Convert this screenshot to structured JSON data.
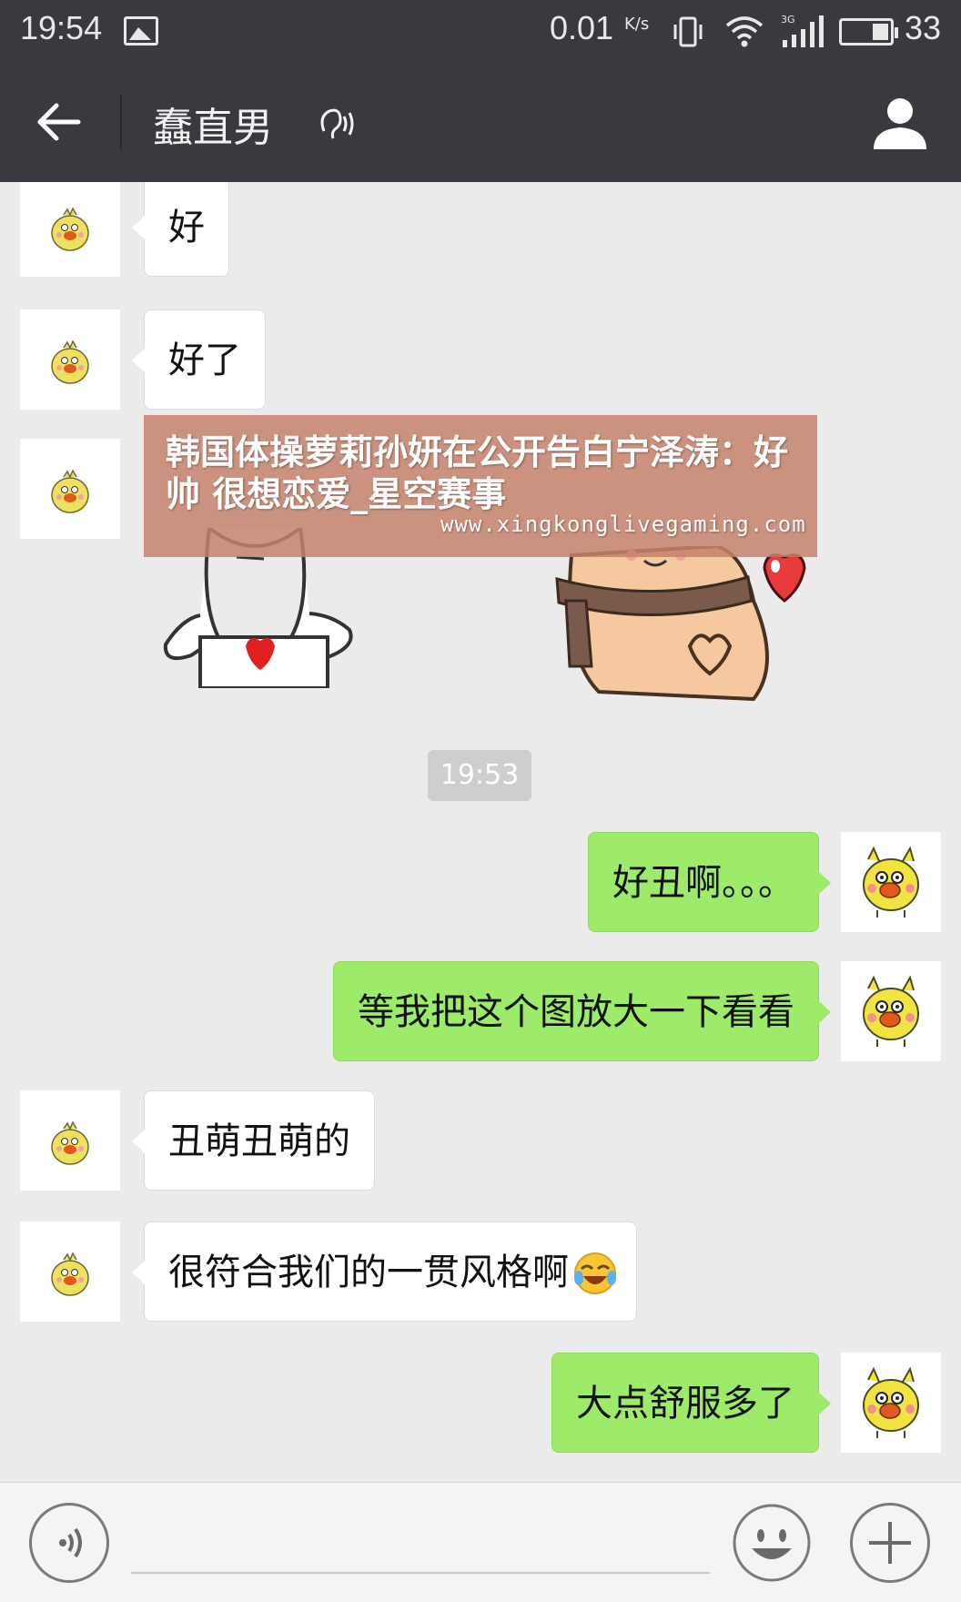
{
  "status_bar": {
    "time": "19:54",
    "net_speed": "0.01",
    "net_speed_unit": "K/s",
    "battery_percent": "33",
    "icons": [
      "gallery-icon",
      "vibrate-icon",
      "wifi-icon",
      "signal-3g-icon",
      "battery-icon"
    ]
  },
  "header": {
    "title": "蠢直男",
    "icons": [
      "back-arrow-icon",
      "earpiece-icon",
      "profile-icon"
    ]
  },
  "messages": [
    {
      "side": "left",
      "text": "好"
    },
    {
      "side": "left",
      "text": "好了"
    },
    {
      "side": "left",
      "type": "sticker"
    },
    {
      "type": "timestamp",
      "text": "19:53"
    },
    {
      "side": "right",
      "text": "好丑啊。。。"
    },
    {
      "side": "right",
      "text": "等我把这个图放大一下看看"
    },
    {
      "side": "left",
      "text": "丑萌丑萌的"
    },
    {
      "side": "left",
      "text": "很符合我们的一贯风格啊",
      "emoji": "laugh-cry-emoji"
    },
    {
      "side": "right",
      "text": "大点舒服多了"
    }
  ],
  "watermark": {
    "title": "韩国体操萝莉孙妍在公开告白宁泽涛：好帅 很想恋爱_星空赛事",
    "url": "www.xingkonglivegaming.com"
  },
  "input_bar": {
    "icons": [
      "voice-icon",
      "emoji-icon",
      "plus-icon"
    ]
  },
  "colors": {
    "header_bg": "#393a3f",
    "chat_bg": "#ebebeb",
    "sent_bubble": "#9eea6a",
    "received_bubble": "#ffffff",
    "timestamp_bg": "#cecece"
  }
}
